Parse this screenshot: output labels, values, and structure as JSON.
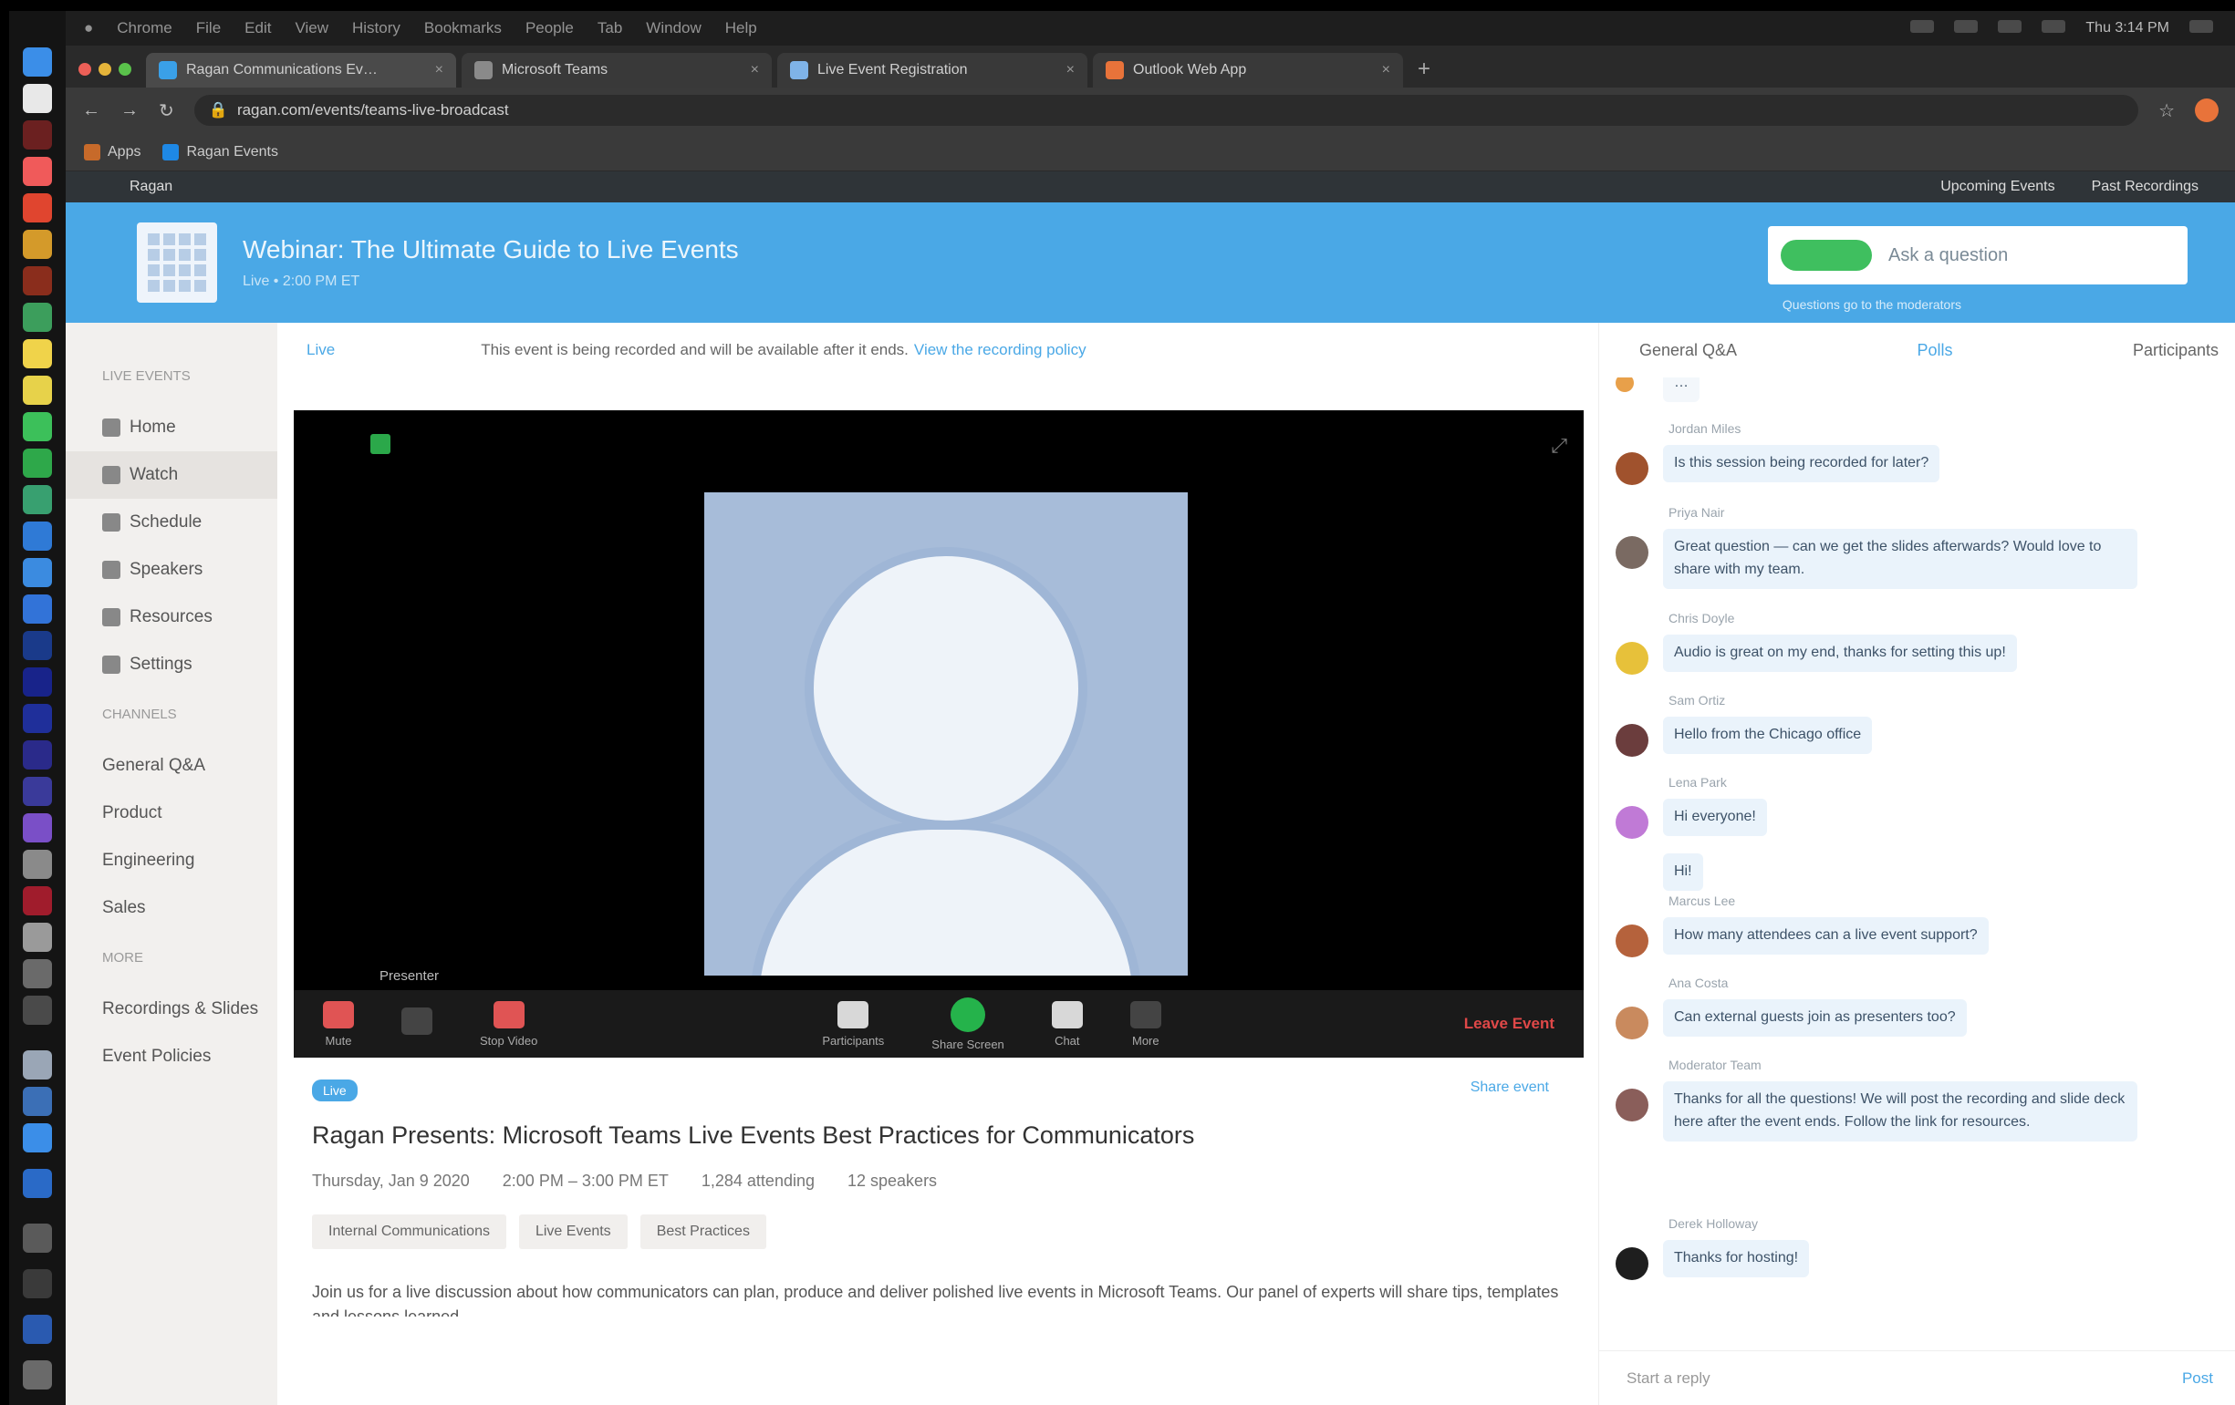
{
  "os_menu": {
    "items": [
      "",
      "Chrome",
      "File",
      "Edit",
      "View",
      "History",
      "Bookmarks",
      "People",
      "Tab",
      "Window",
      "Help"
    ],
    "clock": "Thu 3:14 PM"
  },
  "browser": {
    "tabs": [
      {
        "title": "Ragan Communications Ev…",
        "color": "#3aa0e8"
      },
      {
        "title": "Microsoft Teams",
        "color": "#8a8a8a"
      },
      {
        "title": "Live Event Registration",
        "color": "#7fb3e8"
      },
      {
        "title": "Outlook Web App",
        "color": "#e8733a"
      }
    ],
    "url": "ragan.com/events/teams-live-broadcast",
    "bookmarks": [
      "Apps",
      "Ragan Events"
    ]
  },
  "site": {
    "logo_text": "Ragan",
    "links": [
      "Upcoming Events",
      "Past Recordings"
    ]
  },
  "header": {
    "title": "Webinar: The Ultimate Guide to Live Events",
    "subtitle": "Live • 2:00 PM ET",
    "ask_placeholder": "Ask a question",
    "ask_hint": "Questions go to the moderators"
  },
  "nav": {
    "section1": "LIVE EVENTS",
    "items": [
      {
        "label": "Home",
        "icon": "home-icon"
      },
      {
        "label": "Watch",
        "icon": "play-icon"
      },
      {
        "label": "Schedule",
        "icon": "calendar-icon"
      },
      {
        "label": "Speakers",
        "icon": "people-icon"
      },
      {
        "label": "Resources",
        "icon": "folder-icon"
      },
      {
        "label": "Settings",
        "icon": "gear-icon"
      }
    ],
    "section2": "CHANNELS",
    "channels": [
      "General Q&A",
      "Product",
      "Engineering",
      "Sales"
    ],
    "section3": "MORE",
    "more": [
      "Recordings & Slides",
      "Event Policies"
    ]
  },
  "notice": {
    "flag": "Live",
    "text": "This event is being recorded and will be available after it ends.",
    "link": "View the recording policy"
  },
  "player": {
    "speaker": "Presenter",
    "controls": [
      "Mute",
      "",
      "Stop Video",
      "Participants",
      "Share Screen",
      "Chat",
      "More"
    ],
    "leave": "Leave Event"
  },
  "post": {
    "tag": "Live",
    "share": "Share event",
    "title": "Ragan Presents: Microsoft Teams Live Events Best Practices for Communicators",
    "meta": [
      "Thursday, Jan 9 2020",
      "2:00 PM – 3:00 PM ET",
      "1,284 attending",
      "12 speakers"
    ],
    "chips": [
      "Internal Communications",
      "Live Events",
      "Best Practices"
    ],
    "description": "Join us for a live discussion about how communicators can plan, produce and deliver polished live events in Microsoft Teams. Our panel of experts will share tips, templates and lessons learned."
  },
  "chat": {
    "tabs": [
      "General Q&A",
      "Polls",
      "Participants"
    ],
    "messages": [
      {
        "name": "Jordan Miles",
        "text": "Is this session being recorded for later?",
        "color": "#a0522d"
      },
      {
        "name": "Priya Nair",
        "text": "Great question — can we get the slides afterwards? Would love to share with my team.",
        "color": "#7a6a62"
      },
      {
        "name": "Chris Doyle",
        "text": "Audio is great on my end, thanks for setting this up!",
        "color": "#e7c13a"
      },
      {
        "name": "Sam Ortiz",
        "text": "Hello from the Chicago office",
        "color": "#6b3d3d"
      },
      {
        "name": "Lena Park",
        "text": "Hi everyone!",
        "color": "#c07ad6"
      },
      {
        "name": "",
        "text": "Hi!",
        "color": ""
      },
      {
        "name": "Marcus Lee",
        "text": "How many attendees can a live event support?",
        "color": "#b5623c"
      },
      {
        "name": "Ana Costa",
        "text": "Can external guests join as presenters too?",
        "color": "#c98a5e"
      },
      {
        "name": "Moderator Team",
        "text": "Thanks for all the questions! We will post the recording and slide deck here after the event ends. Follow the link for resources.",
        "color": "#8a5e5a"
      },
      {
        "name": "Derek Holloway",
        "text": "Thanks for hosting!",
        "color": "#1e1e1e"
      }
    ],
    "reply_placeholder": "Start a reply",
    "send_label": "Post"
  }
}
